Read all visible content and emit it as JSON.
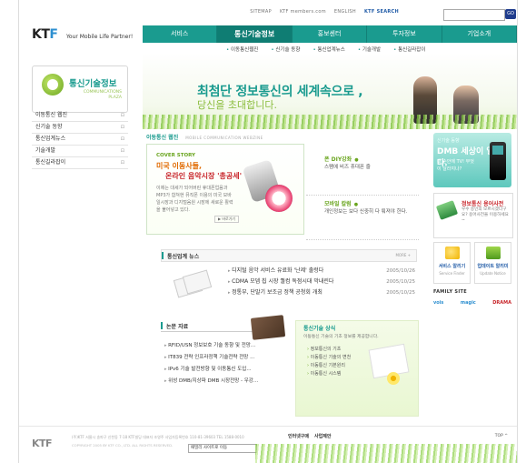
{
  "util": {
    "links": [
      "SITEMAP",
      "KTF members.com",
      "ENGLISH",
      "KTF SEARCH"
    ],
    "go": "GO"
  },
  "brand": {
    "logo_a": "KT",
    "logo_b": "F",
    "tagline": "Your Mobile Life Partner!"
  },
  "gnb": [
    "서비스",
    "통신기술정보",
    "홍보센터",
    "투자정보",
    "기업소개"
  ],
  "subnav": [
    "이동통신웹진",
    "신기술 동향",
    "통신업계뉴스",
    "기술개발",
    "통신길라잡이"
  ],
  "left": {
    "title": "통신기술정보",
    "sub1": "COMMUNICATIONS",
    "sub2": "PLAZA",
    "menu": [
      "이동통신 웹진",
      "신기술 동향",
      "통신업계뉴스",
      "기술개발",
      "통신길라잡이"
    ]
  },
  "hero": {
    "line1": "최첨단 정보통신의 세계속으로 ,",
    "line2": "당신을 초대합니다."
  },
  "webzine": {
    "title": "이동통신 웹진",
    "sub": "MOBILE COMMUNICATION WEBZINE",
    "cover_label": "COVER STORY",
    "cover_t1": "미국 이동사들,",
    "cover_t2": "온라인 음악시장 '총공세'",
    "cover_desc": "이제는 대세가 되어버린 휴대폰업음과 MP3가 합쳐현 뮤직폰 이용의 미국 모바일시장과 디지털음원 시장에 새로운 활력을 불어넣고 있다.",
    "more": "▶ 바로가기"
  },
  "side_boxes": [
    {
      "title": "폰 DIY강좌",
      "desc": "스팸에 비즈 휴대폰 줄"
    },
    {
      "title": "모바일 칼럼",
      "desc": "개인정보는 보다 신중히 다 뤄져야 한다."
    }
  ],
  "news": {
    "title": "통신업계 뉴스",
    "more": "MORE +",
    "items": [
      {
        "text": "디지털 음악 서비스 유료화 '난제' 출렁다",
        "date": "2005/10/26"
      },
      {
        "text": "CDMA 모뎀 칩 시장 퀄컴 독점시대 막내린다",
        "date": "2005/10/25"
      },
      {
        "text": "정통부, 단말기 보조금 정책 공청회 개최",
        "date": "2005/10/25"
      }
    ]
  },
  "papers": {
    "title": "논문 자료",
    "items": [
      "RFID/USN 정보보호 기술 동향 및 전망...",
      "IT839 전략 인프라정책 기술전략 전망 ...",
      "IPv6 기술 발전방향 및 이동통신 도입...",
      "위성 DMB/지상파 DMB 시장전망 - 우강..."
    ]
  },
  "knowledge": {
    "title": "통신기술 상식",
    "desc": "이동통신 기술의 기초 정보를 제공합니다.",
    "items": [
      "정보통신의 기초",
      "이동통신 기술의 변천",
      "이동통신 기본원리",
      "이동통신 시스템"
    ]
  },
  "dmb": {
    "l1": "신기술 동향",
    "l2": "DMB 세상이 열린다.",
    "l3": "내 손안에 TV! 무엇이 달라지나?"
  },
  "term": {
    "title": "정보통신 용어사전",
    "desc": "우수 중인의 모르시겠다구요? 용어사전을 이용하세요~"
  },
  "twin": [
    {
      "title": "서비스 알리기",
      "sub": "Service Finder"
    },
    {
      "title": "업데이트 알리미",
      "sub": "Update Notice"
    }
  ],
  "family": {
    "title": "FAMILY SITE",
    "sites": [
      "vois",
      "magic",
      "DRAMA"
    ]
  },
  "footer": {
    "logo": "KTF",
    "addr": "(주)KTF 서울시 송파구 신천동 7-18 KTF빌딩 대표자 조영주 사업자등록번호 110-81-39603 TEL 1588-0010",
    "copy": "COPYRIGHT 2005 BY KTF CO., LTD. ALL RIGHTS RESERVED.",
    "links": [
      "인터넷구매",
      "사업제안"
    ],
    "select": "패밀리 사이트로 이동",
    "top": "TOP ^"
  },
  "colors": {
    "brand_teal": "#1a9b8f",
    "accent_green": "#6aa51f",
    "accent_red": "#c8262b"
  }
}
